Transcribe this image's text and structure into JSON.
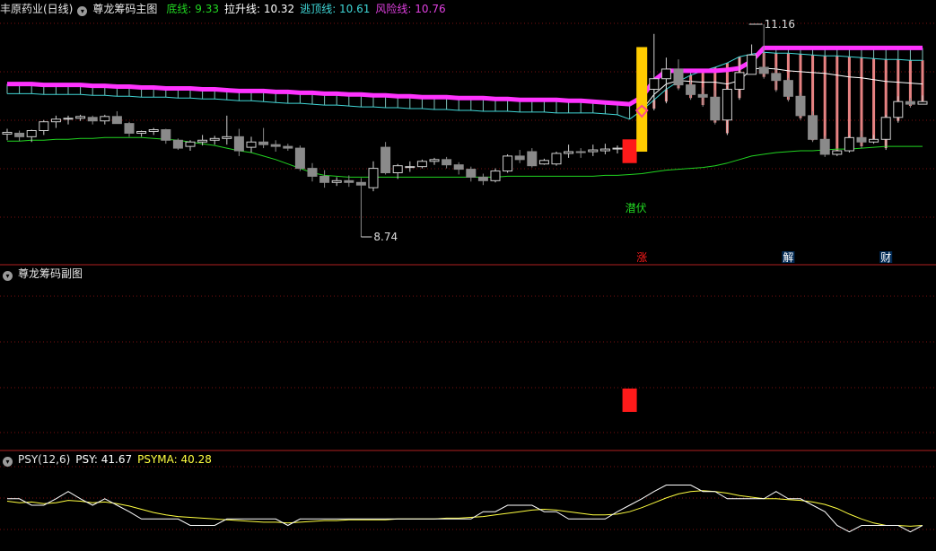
{
  "header_main": {
    "stock": "丰原药业(日线)",
    "indicator": "尊龙筹码主图",
    "lines": [
      {
        "label": "底线:",
        "value": "9.33",
        "color": "#21d421"
      },
      {
        "label": "拉升线:",
        "value": "10.32",
        "color": "#ffffff"
      },
      {
        "label": "逃顶线:",
        "value": "10.61",
        "color": "#3fd6d6"
      },
      {
        "label": "风险线:",
        "value": "10.76",
        "color": "#e040e0"
      }
    ]
  },
  "header_sub": {
    "indicator": "尊龙筹码副图"
  },
  "header_psy": {
    "name": "PSY(12,6)",
    "psy_label": "PSY:",
    "psy_value": "41.67",
    "psy_color": "#ffffff",
    "psyma_label": "PSYMA:",
    "psyma_value": "40.28",
    "psyma_color": "#ffff40"
  },
  "annotations": {
    "high_label": "11.16",
    "low_label": "8.74",
    "qianfu": "潜伏",
    "zhang": "涨",
    "jie": "解",
    "cai": "财"
  },
  "colors": {
    "background": "#000000",
    "grid": "#7a1010",
    "up": "#cfcfcf",
    "down": "#8a8a8a",
    "bottom_line": "#21d421",
    "pull_line": "#ffffff",
    "escape_line": "#3fd6d6",
    "risk_line": "#ff33ff",
    "signal_red": "#ff1a1a",
    "gold": "#ffcc00",
    "pink": "#ff9090"
  },
  "chart_data": {
    "type": "candlestick",
    "candles": [
      [
        9.91,
        9.97,
        9.84,
        9.93
      ],
      [
        9.92,
        9.95,
        9.83,
        9.88
      ],
      [
        9.88,
        9.96,
        9.82,
        9.95
      ],
      [
        9.95,
        10.07,
        9.9,
        10.05
      ],
      [
        10.05,
        10.12,
        9.98,
        10.08
      ],
      [
        10.09,
        10.12,
        10.02,
        10.09
      ],
      [
        10.09,
        10.13,
        10.06,
        10.11
      ],
      [
        10.1,
        10.12,
        10.02,
        10.06
      ],
      [
        10.06,
        10.13,
        10.02,
        10.11
      ],
      [
        10.11,
        10.17,
        10.04,
        10.03
      ],
      [
        10.03,
        10.05,
        9.88,
        9.92
      ],
      [
        9.92,
        9.95,
        9.88,
        9.94
      ],
      [
        9.94,
        9.98,
        9.9,
        9.96
      ],
      [
        9.96,
        9.97,
        9.8,
        9.84
      ],
      [
        9.84,
        9.86,
        9.73,
        9.75
      ],
      [
        9.77,
        9.84,
        9.72,
        9.82
      ],
      [
        9.82,
        9.9,
        9.78,
        9.84
      ],
      [
        9.84,
        9.89,
        9.79,
        9.86
      ],
      [
        9.86,
        10.12,
        9.79,
        9.88
      ],
      [
        9.88,
        9.97,
        9.66,
        9.72
      ],
      [
        9.76,
        9.88,
        9.7,
        9.82
      ],
      [
        9.82,
        9.98,
        9.75,
        9.79
      ],
      [
        9.79,
        9.84,
        9.71,
        9.77
      ],
      [
        9.77,
        9.8,
        9.72,
        9.75
      ],
      [
        9.75,
        9.78,
        9.49,
        9.52
      ],
      [
        9.52,
        9.58,
        9.37,
        9.43
      ],
      [
        9.43,
        9.5,
        9.3,
        9.36
      ],
      [
        9.36,
        9.42,
        9.32,
        9.38
      ],
      [
        9.38,
        9.44,
        9.31,
        9.36
      ],
      [
        9.36,
        9.41,
        8.74,
        9.33
      ],
      [
        9.3,
        9.6,
        9.26,
        9.52
      ],
      [
        9.76,
        9.82,
        9.45,
        9.47
      ],
      [
        9.47,
        9.57,
        9.4,
        9.55
      ],
      [
        9.53,
        9.6,
        9.48,
        9.54
      ],
      [
        9.54,
        9.62,
        9.52,
        9.6
      ],
      [
        9.6,
        9.64,
        9.56,
        9.62
      ],
      [
        9.62,
        9.65,
        9.52,
        9.56
      ],
      [
        9.56,
        9.59,
        9.45,
        9.51
      ],
      [
        9.51,
        9.54,
        9.37,
        9.42
      ],
      [
        9.42,
        9.46,
        9.33,
        9.38
      ],
      [
        9.38,
        9.52,
        9.36,
        9.49
      ],
      [
        9.49,
        9.68,
        9.47,
        9.66
      ],
      [
        9.66,
        9.73,
        9.58,
        9.62
      ],
      [
        9.71,
        9.75,
        9.53,
        9.55
      ],
      [
        9.57,
        9.63,
        9.56,
        9.61
      ],
      [
        9.57,
        9.71,
        9.55,
        9.69
      ],
      [
        9.69,
        9.79,
        9.64,
        9.71
      ],
      [
        9.71,
        9.75,
        9.64,
        9.7
      ],
      [
        9.71,
        9.79,
        9.66,
        9.73
      ],
      [
        9.72,
        9.8,
        9.68,
        9.74
      ],
      [
        9.74,
        9.78,
        9.69,
        9.75
      ],
      [
        9.75,
        9.79,
        9.64,
        9.68
      ],
      [
        9.72,
        10.58,
        9.71,
        10.42
      ],
      [
        10.42,
        11.05,
        10.18,
        10.54
      ],
      [
        10.54,
        10.78,
        10.26,
        10.65
      ],
      [
        10.65,
        10.76,
        10.41,
        10.47
      ],
      [
        10.47,
        10.53,
        10.3,
        10.36
      ],
      [
        10.36,
        10.44,
        10.22,
        10.33
      ],
      [
        10.33,
        10.41,
        10.02,
        10.07
      ],
      [
        10.07,
        10.46,
        9.9,
        10.42
      ],
      [
        10.42,
        10.78,
        10.3,
        10.61
      ],
      [
        10.59,
        10.93,
        10.59,
        10.81
      ],
      [
        10.67,
        11.16,
        10.54,
        10.6
      ],
      [
        10.6,
        10.68,
        10.39,
        10.52
      ],
      [
        10.52,
        10.55,
        10.28,
        10.34
      ],
      [
        10.34,
        10.38,
        10.07,
        10.12
      ],
      [
        10.12,
        10.17,
        9.82,
        9.85
      ],
      [
        9.85,
        9.89,
        9.65,
        9.68
      ],
      [
        9.68,
        9.73,
        9.66,
        9.72
      ],
      [
        9.72,
        9.89,
        9.7,
        9.87
      ],
      [
        9.87,
        9.95,
        9.75,
        9.82
      ],
      [
        9.82,
        9.9,
        9.8,
        9.85
      ],
      [
        9.85,
        10.13,
        9.73,
        10.1
      ],
      [
        10.1,
        10.34,
        10.04,
        10.28
      ],
      [
        10.28,
        10.32,
        10.21,
        10.25
      ],
      [
        10.25,
        10.35,
        10.25,
        10.28
      ]
    ],
    "bottom_line": [
      9.83,
      9.83,
      9.84,
      9.84,
      9.85,
      9.85,
      9.86,
      9.86,
      9.87,
      9.87,
      9.87,
      9.87,
      9.86,
      9.85,
      9.84,
      9.82,
      9.8,
      9.78,
      9.75,
      9.72,
      9.7,
      9.66,
      9.62,
      9.57,
      9.52,
      9.47,
      9.44,
      9.43,
      9.42,
      9.42,
      9.42,
      9.42,
      9.42,
      9.42,
      9.42,
      9.42,
      9.42,
      9.42,
      9.42,
      9.42,
      9.42,
      9.43,
      9.43,
      9.43,
      9.43,
      9.43,
      9.43,
      9.43,
      9.43,
      9.44,
      9.44,
      9.45,
      9.46,
      9.48,
      9.5,
      9.51,
      9.52,
      9.53,
      9.55,
      9.58,
      9.62,
      9.66,
      9.68,
      9.7,
      9.71,
      9.72,
      9.72,
      9.73,
      9.74,
      9.74,
      9.75,
      9.76,
      9.77,
      9.77,
      9.77,
      9.77
    ],
    "pull_line": [
      null,
      null,
      null,
      null,
      null,
      null,
      null,
      null,
      null,
      null,
      null,
      null,
      null,
      null,
      null,
      null,
      null,
      null,
      null,
      null,
      null,
      null,
      null,
      null,
      null,
      null,
      null,
      null,
      null,
      null,
      null,
      null,
      null,
      null,
      null,
      null,
      null,
      null,
      null,
      null,
      null,
      null,
      null,
      null,
      null,
      null,
      null,
      null,
      null,
      null,
      null,
      null,
      10.18,
      10.36,
      10.48,
      10.52,
      10.51,
      10.5,
      10.5,
      10.48,
      10.52,
      10.65,
      10.66,
      10.65,
      10.63,
      10.62,
      10.61,
      10.6,
      10.58,
      10.56,
      10.55,
      10.53,
      10.51,
      10.5,
      10.49,
      10.48
    ],
    "escape_line": [
      10.37,
      10.37,
      10.37,
      10.36,
      10.36,
      10.36,
      10.36,
      10.35,
      10.35,
      10.34,
      10.34,
      10.33,
      10.33,
      10.33,
      10.32,
      10.32,
      10.31,
      10.31,
      10.3,
      10.29,
      10.29,
      10.28,
      10.27,
      10.26,
      10.26,
      10.25,
      10.24,
      10.24,
      10.23,
      10.22,
      10.22,
      10.21,
      10.21,
      10.2,
      10.2,
      10.19,
      10.19,
      10.18,
      10.18,
      10.17,
      10.17,
      10.17,
      10.16,
      10.16,
      10.16,
      10.15,
      10.15,
      10.15,
      10.15,
      10.14,
      10.13,
      10.08,
      10.18,
      10.3,
      10.42,
      10.51,
      10.58,
      10.63,
      10.67,
      10.72,
      10.79,
      10.82,
      10.84,
      10.83,
      10.83,
      10.82,
      10.81,
      10.8,
      10.8,
      10.79,
      10.78,
      10.77,
      10.76,
      10.76,
      10.75,
      10.75
    ],
    "risk_line": [
      10.48,
      10.48,
      10.48,
      10.47,
      10.47,
      10.47,
      10.47,
      10.46,
      10.46,
      10.45,
      10.45,
      10.44,
      10.44,
      10.43,
      10.43,
      10.43,
      10.42,
      10.42,
      10.41,
      10.4,
      10.4,
      10.4,
      10.39,
      10.39,
      10.38,
      10.38,
      10.37,
      10.37,
      10.36,
      10.36,
      10.35,
      10.35,
      10.34,
      10.34,
      10.33,
      10.33,
      10.33,
      10.32,
      10.32,
      10.32,
      10.31,
      10.31,
      10.3,
      10.3,
      10.3,
      10.3,
      10.29,
      10.29,
      10.28,
      10.27,
      10.26,
      10.25,
      10.33,
      10.52,
      10.63,
      10.63,
      10.63,
      10.63,
      10.63,
      10.64,
      10.66,
      10.74,
      10.89,
      10.89,
      10.89,
      10.89,
      10.89,
      10.89,
      10.89,
      10.89,
      10.89,
      10.89,
      10.89,
      10.89,
      10.89,
      10.89
    ],
    "psy": [
      58,
      58,
      50,
      50,
      58,
      67,
      58,
      50,
      58,
      50,
      42,
      33,
      33,
      33,
      33,
      25,
      25,
      25,
      33,
      33,
      33,
      33,
      33,
      25,
      33,
      33,
      33,
      33,
      33,
      33,
      33,
      33,
      33,
      33,
      33,
      33,
      33,
      33,
      33,
      42,
      42,
      50,
      50,
      50,
      42,
      42,
      33,
      33,
      33,
      33,
      42,
      50,
      58,
      67,
      75,
      75,
      75,
      67,
      67,
      58,
      58,
      58,
      58,
      67,
      58,
      58,
      50,
      42,
      25,
      17,
      25,
      25,
      25,
      25,
      17,
      25
    ],
    "psyma": [
      55,
      53,
      54,
      52,
      53,
      56,
      55,
      53,
      54,
      52,
      49,
      45,
      41,
      38,
      36,
      35,
      34,
      33,
      32,
      31,
      30,
      29,
      29,
      28,
      29,
      30,
      31,
      31,
      32,
      32,
      32,
      32,
      33,
      33,
      33,
      33,
      34,
      34,
      35,
      36,
      38,
      40,
      42,
      44,
      45,
      44,
      42,
      40,
      38,
      38,
      39,
      42,
      47,
      53,
      59,
      64,
      67,
      68,
      67,
      65,
      62,
      60,
      58,
      58,
      57,
      56,
      54,
      51,
      46,
      39,
      33,
      28,
      25,
      25,
      24,
      25
    ]
  }
}
